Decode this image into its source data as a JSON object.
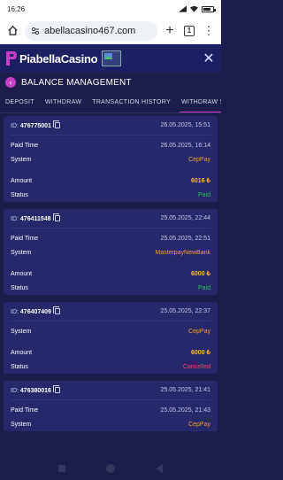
{
  "status_bar": {
    "time": "16:26",
    "battery_percent": 80
  },
  "browser": {
    "url": "abellacasino467.com",
    "tab_count": "1"
  },
  "app": {
    "logo_text": "PiabellaCasino"
  },
  "page": {
    "title": "BALANCE MANAGEMENT"
  },
  "tabs": [
    {
      "label": "DEPOSIT",
      "active": false
    },
    {
      "label": "WITHDRAW",
      "active": false
    },
    {
      "label": "TRANSACTION HISTORY",
      "active": false
    },
    {
      "label": "WITHDRAW STA",
      "active": true
    }
  ],
  "cards": [
    {
      "id_label": "ID:",
      "id": "476775001",
      "date": "26.05.2025, 15:51",
      "rows": [
        {
          "label": "Paid Time",
          "value": "26.05.2025, 16:14",
          "kind": "date"
        },
        {
          "label": "System",
          "value": "CepPay",
          "kind": "sys"
        },
        {
          "label": "Amount",
          "value": "6016 ₺",
          "kind": "amt",
          "gap": true
        },
        {
          "label": "Status",
          "value": "Paid",
          "kind": "paid"
        }
      ]
    },
    {
      "id_label": "ID:",
      "id": "476411548",
      "date": "25.05.2025, 22:44",
      "rows": [
        {
          "label": "Paid Time",
          "value": "25.05.2025, 22:51",
          "kind": "date"
        },
        {
          "label": "System",
          "value": "MasterpayNewBank",
          "kind": "sys"
        },
        {
          "label": "Amount",
          "value": "6000 ₺",
          "kind": "amt",
          "gap": true
        },
        {
          "label": "Status",
          "value": "Paid",
          "kind": "paid"
        }
      ]
    },
    {
      "id_label": "ID:",
      "id": "476407409",
      "date": "25.05.2025, 22:37",
      "rows": [
        {
          "label": "System",
          "value": "CepPay",
          "kind": "sys"
        },
        {
          "label": "Amount",
          "value": "6000 ₺",
          "kind": "amt",
          "gap": true
        },
        {
          "label": "Status",
          "value": "Cancelled",
          "kind": "cancel"
        }
      ]
    },
    {
      "id_label": "ID:",
      "id": "476380016",
      "date": "25.05.2025, 21:41",
      "rows": [
        {
          "label": "Paid Time",
          "value": "25.05.2025, 21:43",
          "kind": "date"
        },
        {
          "label": "System",
          "value": "CepPay",
          "kind": "sys"
        }
      ]
    }
  ],
  "colors": {
    "accent": "#c740c7",
    "bg": "#1c1d4a",
    "card": "#26286a",
    "paid": "#22c55e",
    "cancelled": "#ff3b5c",
    "amount": "#ffb830"
  }
}
